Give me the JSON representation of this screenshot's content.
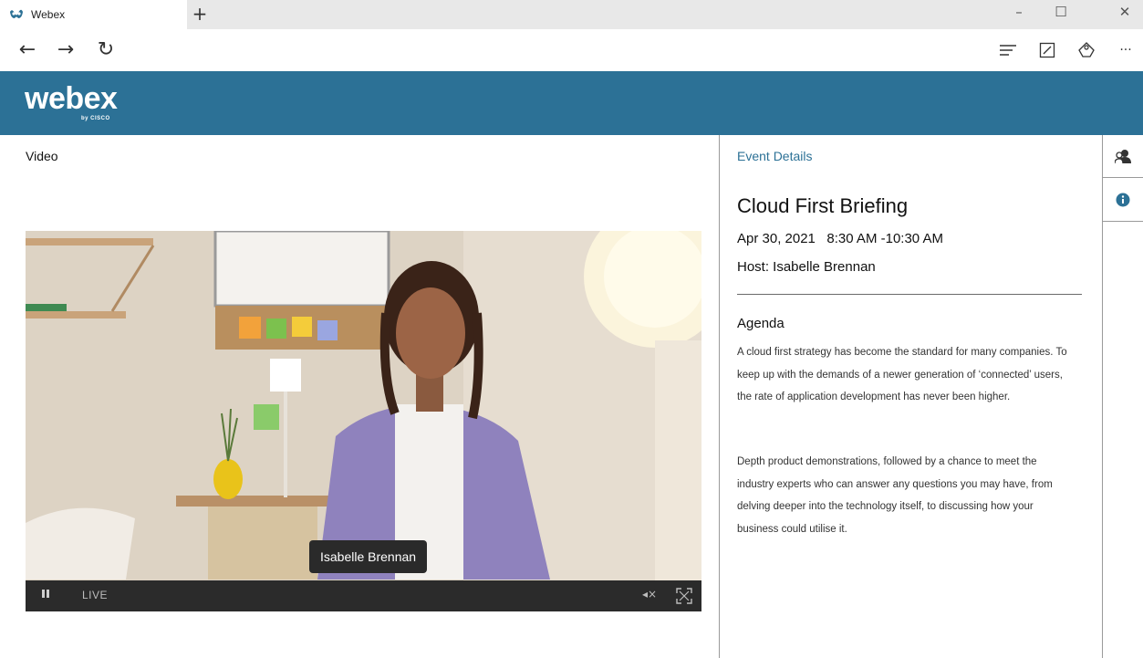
{
  "browser": {
    "tab_title": "Webex",
    "new_tab_label": "+",
    "window_controls": {
      "minimize": "–",
      "maximize": "☐",
      "close": "✕"
    },
    "nav": {
      "back": "←",
      "forward": "→",
      "refresh": "↻"
    },
    "toolbar_icons": [
      "reading-list-icon",
      "notes-icon",
      "share-icon",
      "more-icon"
    ],
    "more_label": "···"
  },
  "brand": {
    "logo_text": "webex",
    "logo_subtext": "by CISCO",
    "header_color": "#2c7196"
  },
  "video": {
    "section_label": "Video",
    "speaker_name": "Isabelle Brennan",
    "status_label": "LIVE",
    "mute_label": "◂×"
  },
  "details": {
    "tab_label": "Event Details",
    "event_title": "Cloud First Briefing",
    "date_time": "Apr 30, 2021   8:30 AM -10:30 AM",
    "host": "Host: Isabelle Brennan",
    "agenda_heading": "Agenda",
    "agenda_paragraph_1": "A cloud first strategy has become the standard for many companies. To keep up with the demands of a newer generation of ‘connected’ users, the rate of application development has never been higher.",
    "agenda_paragraph_2": "Depth product demonstrations, followed by a chance to meet the industry experts who can answer any questions you may have, from delving deeper into the technology itself, to discussing how your business could utilise it."
  },
  "rail": {
    "items": [
      "participants-icon",
      "info-icon"
    ],
    "accent_color": "#2c7196"
  }
}
